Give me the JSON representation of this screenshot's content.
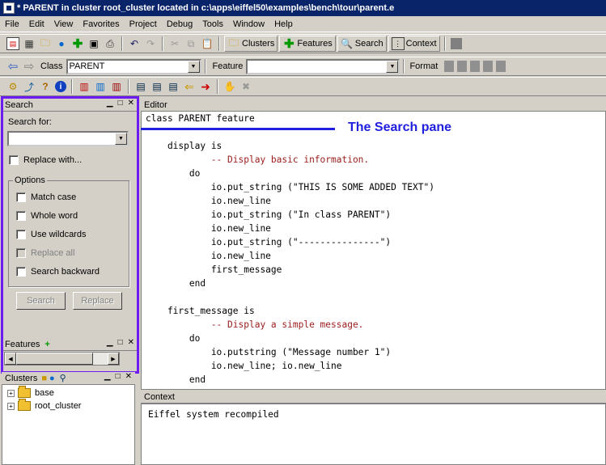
{
  "window": {
    "title": "* PARENT  in cluster root_cluster   located in c:\\apps\\eiffel50\\examples\\bench\\tour\\parent.e"
  },
  "menu": [
    "File",
    "Edit",
    "View",
    "Favorites",
    "Project",
    "Debug",
    "Tools",
    "Window",
    "Help"
  ],
  "toolbar": {
    "clusters_label": "Clusters",
    "features_label": "Features",
    "search_label": "Search",
    "context_label": "Context"
  },
  "addressbar": {
    "class_label": "Class",
    "class_value": "PARENT",
    "feature_label": "Feature",
    "feature_value": "",
    "format_label": "Format"
  },
  "search_pane": {
    "title": "Search",
    "search_for_label": "Search for:",
    "search_value": "",
    "replace_with_label": "Replace with...",
    "options_label": "Options",
    "options": [
      {
        "label": "Match case",
        "checked": false,
        "enabled": true
      },
      {
        "label": "Whole word",
        "checked": false,
        "enabled": true
      },
      {
        "label": "Use wildcards",
        "checked": false,
        "enabled": true
      },
      {
        "label": "Replace all",
        "checked": false,
        "enabled": false
      },
      {
        "label": "Search backward",
        "checked": false,
        "enabled": true
      }
    ],
    "search_button": "Search",
    "replace_button": "Replace"
  },
  "features_pane": {
    "title": "Features"
  },
  "clusters_pane": {
    "title": "Clusters",
    "items": [
      {
        "label": "base"
      },
      {
        "label": "root_cluster"
      }
    ]
  },
  "editor": {
    "title": "Editor",
    "lines": [
      {
        "text": "class PARENT feature",
        "comment": false
      },
      {
        "text": "",
        "comment": false
      },
      {
        "text": "    display is",
        "comment": false
      },
      {
        "text": "            -- Display basic information.",
        "comment": true
      },
      {
        "text": "        do",
        "comment": false
      },
      {
        "text": "            io.put_string (\"THIS IS SOME ADDED TEXT\")",
        "comment": false
      },
      {
        "text": "            io.new_line",
        "comment": false
      },
      {
        "text": "            io.put_string (\"In class PARENT\")",
        "comment": false
      },
      {
        "text": "            io.new_line",
        "comment": false
      },
      {
        "text": "            io.put_string (\"---------------\")",
        "comment": false
      },
      {
        "text": "            io.new_line",
        "comment": false
      },
      {
        "text": "            first_message",
        "comment": false
      },
      {
        "text": "        end",
        "comment": false
      },
      {
        "text": "",
        "comment": false
      },
      {
        "text": "    first_message is",
        "comment": false
      },
      {
        "text": "            -- Display a simple message.",
        "comment": true
      },
      {
        "text": "        do",
        "comment": false
      },
      {
        "text": "            io.putstring (\"Message number 1\")",
        "comment": false
      },
      {
        "text": "            io.new_line; io.new_line",
        "comment": false
      },
      {
        "text": "        end",
        "comment": false
      }
    ]
  },
  "context_pane": {
    "title": "Context",
    "text": "Eiffel system recompiled"
  },
  "annotation": {
    "text": "The Search pane",
    "color": "#2020e0"
  },
  "highlight_color": "#6c1cf0"
}
